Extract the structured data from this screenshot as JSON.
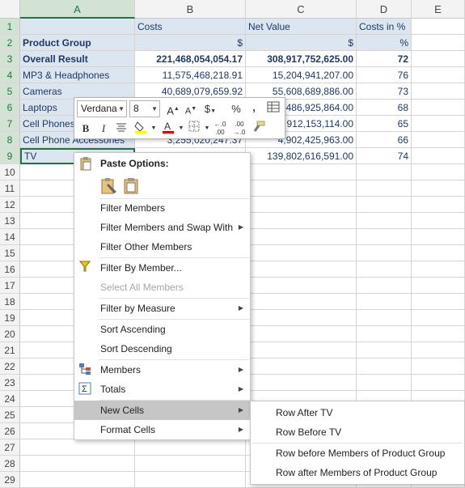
{
  "columns": [
    "A",
    "B",
    "C",
    "D",
    "E"
  ],
  "row_numbers": [
    "1",
    "2",
    "3",
    "4",
    "5",
    "6",
    "7",
    "8",
    "9",
    "10",
    "11",
    "12",
    "13",
    "14",
    "15",
    "16",
    "17",
    "18",
    "19",
    "20",
    "21",
    "22",
    "23",
    "24",
    "25",
    "26",
    "27",
    "28",
    "29"
  ],
  "table": {
    "header": [
      "",
      "Costs",
      "Net Value",
      "Costs in %"
    ],
    "units": [
      "Product Group",
      "$",
      "$",
      "%"
    ],
    "overall": [
      "Overall Result",
      "221,468,054,054.17",
      "308,917,752,625.00",
      "72"
    ],
    "rows": [
      [
        "MP3 & Headphones",
        "11,575,468,218.91",
        "15,204,941,207.00",
        "76"
      ],
      [
        "Cameras",
        "40,689,079,659.92",
        "55,608,689,886.00",
        "73"
      ],
      [
        "Laptops",
        "",
        "486,925,864.00",
        "68"
      ],
      [
        "Cell Phones",
        "",
        "912,153,114.00",
        "65"
      ],
      [
        "Cell Phone Accessories",
        "3,255,020,247.37",
        "4,902,425,963.00",
        "66"
      ],
      [
        "TV",
        "",
        "139,802,616,591.00",
        "74"
      ]
    ]
  },
  "mini_toolbar": {
    "font": "Verdana",
    "size": "8",
    "bold": "B",
    "italic": "I",
    "currency": "$",
    "percent": "%",
    "comma": ","
  },
  "context_menu": {
    "paste_options_label": "Paste Options:",
    "items": [
      {
        "label": "Filter Members",
        "submenu": false,
        "disabled": false
      },
      {
        "label": "Filter Members and Swap With",
        "submenu": true,
        "disabled": false
      },
      {
        "label": "Filter Other Members",
        "submenu": false,
        "disabled": false
      },
      {
        "label": "Filter By Member...",
        "submenu": false,
        "disabled": false
      },
      {
        "label": "Select All Members",
        "submenu": false,
        "disabled": true
      },
      {
        "label": "Filter by Measure",
        "submenu": true,
        "disabled": false
      },
      {
        "label": "Sort Ascending",
        "submenu": false,
        "disabled": false
      },
      {
        "label": "Sort Descending",
        "submenu": false,
        "disabled": false
      },
      {
        "label": "Members",
        "submenu": true,
        "disabled": false
      },
      {
        "label": "Totals",
        "submenu": true,
        "disabled": false
      },
      {
        "label": "New Cells",
        "submenu": true,
        "disabled": false
      },
      {
        "label": "Format Cells",
        "submenu": true,
        "disabled": false
      }
    ]
  },
  "submenu": {
    "items": [
      "Row After TV",
      "Row Before TV",
      "Row before Members of Product Group",
      "Row after Members of Product Group"
    ]
  },
  "colors": {
    "header_fill": "#dce6f1",
    "text": "#1f3864",
    "selection": "#217346",
    "menu_highlight": "#c6c6c6"
  }
}
